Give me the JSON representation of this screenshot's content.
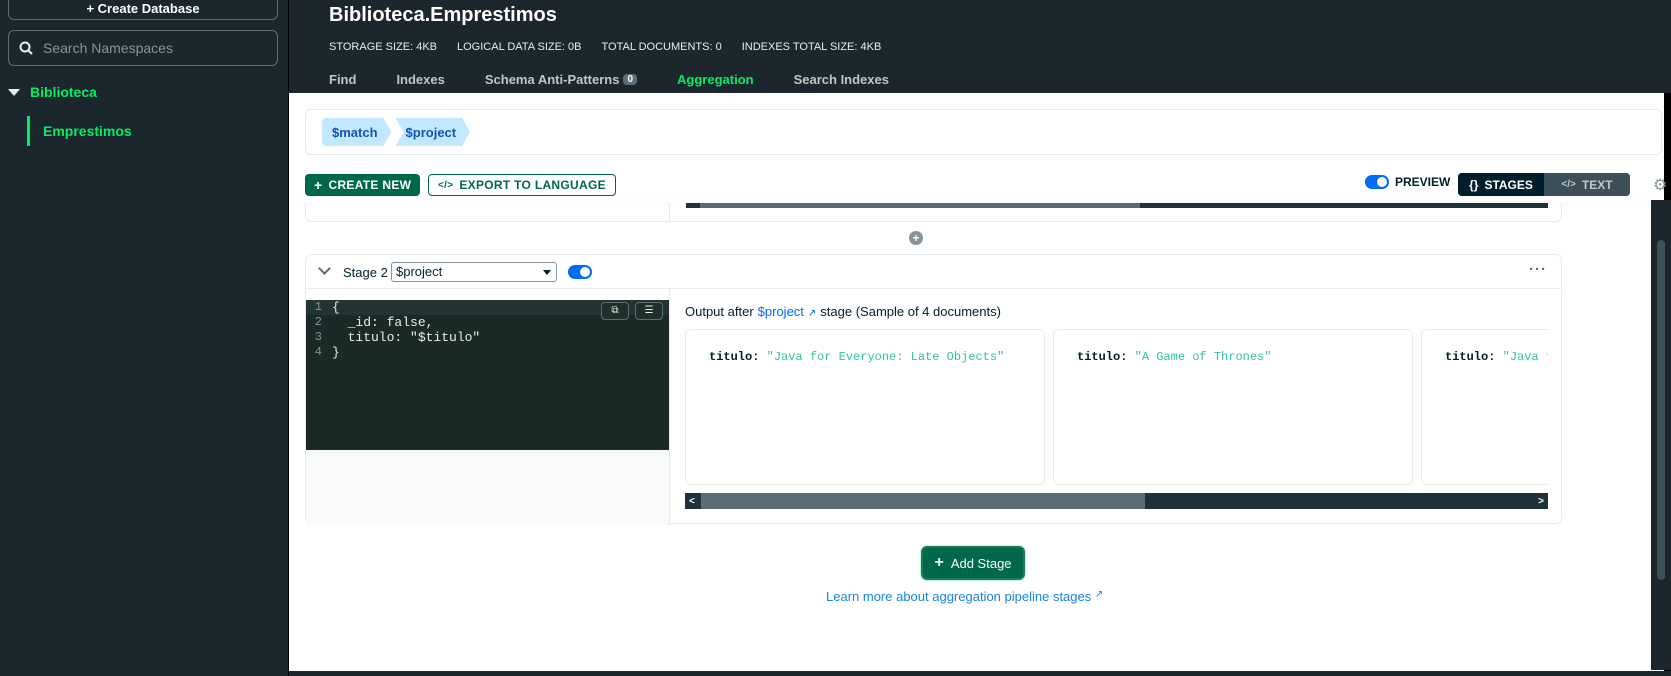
{
  "sidebar": {
    "create_db_label": "+ Create Database",
    "search_placeholder": "Search Namespaces",
    "database": "Biblioteca",
    "collection": "Emprestimos"
  },
  "header": {
    "namespace": "Biblioteca.Emprestimos",
    "stats": {
      "storage": "STORAGE SIZE: 4KB",
      "logical": "LOGICAL DATA SIZE: 0B",
      "docs": "TOTAL DOCUMENTS: 0",
      "indexes": "INDEXES TOTAL SIZE: 4KB"
    },
    "tabs": {
      "find": "Find",
      "indexes": "Indexes",
      "schema": "Schema Anti-Patterns",
      "schema_count": "0",
      "aggregation": "Aggregation",
      "search": "Search Indexes"
    }
  },
  "pipeline": {
    "stages": [
      "$match",
      "$project"
    ]
  },
  "toolbar": {
    "create_new": "CREATE NEW",
    "export": "EXPORT TO LANGUAGE",
    "preview": "PREVIEW",
    "stages": "STAGES",
    "text": "TEXT"
  },
  "stage": {
    "label": "Stage 2",
    "operator": "$project",
    "code_lines": [
      "{",
      "  _id: false,",
      "  titulo: \"$titulo\"",
      "}"
    ],
    "output_prefix": "Output after",
    "output_link": "$project",
    "output_suffix": "stage (Sample of 4 documents)",
    "docs": [
      {
        "key": "titulo:",
        "value": "\"Java for Everyone: Late Objects\""
      },
      {
        "key": "titulo:",
        "value": "\"A Game of Thrones\""
      },
      {
        "key": "titulo:",
        "value": "\"Java fo"
      }
    ]
  },
  "footer": {
    "add_stage": "Add Stage",
    "learn_more": "Learn more about aggregation pipeline stages"
  },
  "colors": {
    "accent_green": "#00ed64",
    "dark_green": "#00684a",
    "link_blue": "#016bf8"
  }
}
